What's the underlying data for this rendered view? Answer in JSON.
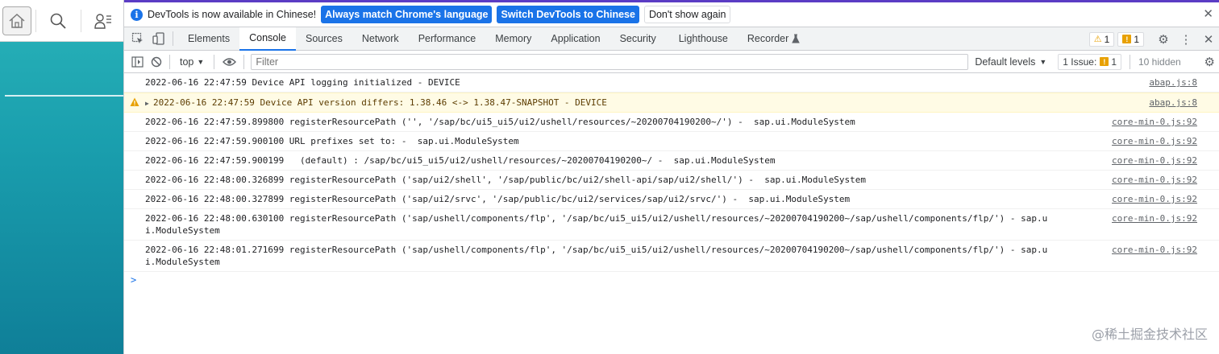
{
  "left_panel": {
    "icons": [
      "home-icon",
      "search-icon",
      "user-menu-icon"
    ]
  },
  "infobar": {
    "message": "DevTools is now available in Chinese!",
    "btn_match": "Always match Chrome's language",
    "btn_switch": "Switch DevTools to Chinese",
    "btn_dismiss": "Don't show again"
  },
  "tabs": [
    {
      "label": "Elements"
    },
    {
      "label": "Console"
    },
    {
      "label": "Sources"
    },
    {
      "label": "Network"
    },
    {
      "label": "Performance"
    },
    {
      "label": "Memory"
    },
    {
      "label": "Application"
    },
    {
      "label": "Security"
    },
    {
      "label": "Lighthouse"
    },
    {
      "label": "Recorder"
    }
  ],
  "active_tab": "Console",
  "badges": {
    "warnings": "1",
    "issues": "1"
  },
  "console_toolbar": {
    "context": "top",
    "filter_placeholder": "Filter",
    "levels": "Default levels",
    "issues_label": "1 Issue:",
    "issues_count": "1",
    "hidden": "10 hidden"
  },
  "messages": [
    {
      "text": "2022-06-16 22:47:59 Device API logging initialized - DEVICE",
      "source": "abap.js:8",
      "level": "info"
    },
    {
      "text": "2022-06-16 22:47:59 Device API version differs: 1.38.46 <-> 1.38.47-SNAPSHOT - DEVICE",
      "source": "abap.js:8",
      "level": "warning"
    },
    {
      "text": "2022-06-16 22:47:59.899800 registerResourcePath ('', '/sap/bc/ui5_ui5/ui2/ushell/resources/~20200704190200~/') -  sap.ui.ModuleSystem",
      "source": "core-min-0.js:92",
      "level": "info"
    },
    {
      "text": "2022-06-16 22:47:59.900100 URL prefixes set to: -  sap.ui.ModuleSystem",
      "source": "core-min-0.js:92",
      "level": "info"
    },
    {
      "text": "2022-06-16 22:47:59.900199   (default) : /sap/bc/ui5_ui5/ui2/ushell/resources/~20200704190200~/ -  sap.ui.ModuleSystem",
      "source": "core-min-0.js:92",
      "level": "info"
    },
    {
      "text": "2022-06-16 22:48:00.326899 registerResourcePath ('sap/ui2/shell', '/sap/public/bc/ui2/shell-api/sap/ui2/shell/') -  sap.ui.ModuleSystem",
      "source": "core-min-0.js:92",
      "level": "info"
    },
    {
      "text": "2022-06-16 22:48:00.327899 registerResourcePath ('sap/ui2/srvc', '/sap/public/bc/ui2/services/sap/ui2/srvc/') -  sap.ui.ModuleSystem",
      "source": "core-min-0.js:92",
      "level": "info"
    },
    {
      "text": "2022-06-16 22:48:00.630100 registerResourcePath ('sap/ushell/components/flp', '/sap/bc/ui5_ui5/ui2/ushell/resources/~20200704190200~/sap/ushell/components/flp/') - sap.ui.ModuleSystem",
      "source": "core-min-0.js:92",
      "level": "info"
    },
    {
      "text": "2022-06-16 22:48:01.271699 registerResourcePath ('sap/ushell/components/flp', '/sap/bc/ui5_ui5/ui2/ushell/resources/~20200704190200~/sap/ushell/components/flp/') - sap.ui.ModuleSystem",
      "source": "core-min-0.js:92",
      "level": "info"
    }
  ],
  "prompt_symbol": ">",
  "watermark": "@稀土掘金技术社区",
  "colors": {
    "accent": "#1a73e8",
    "warning": "#e8a102",
    "panel_teal": "#1a9fae"
  }
}
